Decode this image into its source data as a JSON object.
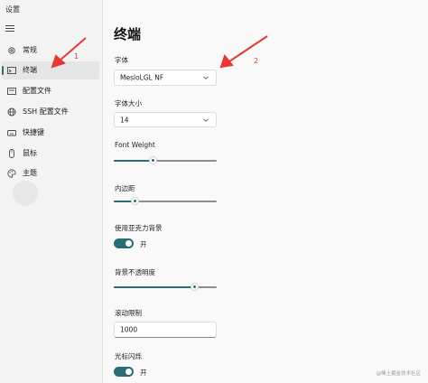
{
  "window": {
    "title": "设置"
  },
  "sidebar": {
    "items": [
      {
        "label": "常规",
        "icon": "gear-icon",
        "selected": false
      },
      {
        "label": "终端",
        "icon": "terminal-icon",
        "selected": true
      },
      {
        "label": "配置文件",
        "icon": "profile-icon",
        "selected": false
      },
      {
        "label": "SSH 配置文件",
        "icon": "globe-icon",
        "selected": false
      },
      {
        "label": "快捷键",
        "icon": "keyboard-icon",
        "selected": false
      },
      {
        "label": "鼠标",
        "icon": "mouse-icon",
        "selected": false
      },
      {
        "label": "主题",
        "icon": "palette-icon",
        "selected": false
      }
    ]
  },
  "main": {
    "title": "终端",
    "font": {
      "label": "字体",
      "value": "MesloLGL NF"
    },
    "font_size": {
      "label": "字体大小",
      "value": "14"
    },
    "font_weight": {
      "label": "Font Weight",
      "level": 0.38
    },
    "padding": {
      "label": "内边距",
      "level": 0.2
    },
    "acrylic": {
      "label": "使用亚克力背景",
      "on": true,
      "state_text": "开"
    },
    "opacity": {
      "label": "背景不透明度",
      "level": 0.78
    },
    "scroll_limit": {
      "label": "滚动限制",
      "value": "1000"
    },
    "cursor_blink": {
      "label": "光标闪烁",
      "on": true,
      "state_text": "开"
    }
  },
  "annotations": {
    "arrow1": "1",
    "arrow2": "2"
  },
  "watermark": "@稀土掘金技术社区",
  "colors": {
    "accent": "#2a6b74",
    "annotation": "#e53935",
    "panel_bg": "#f9f9f9",
    "sidebar_bg": "#f3f3f3"
  }
}
